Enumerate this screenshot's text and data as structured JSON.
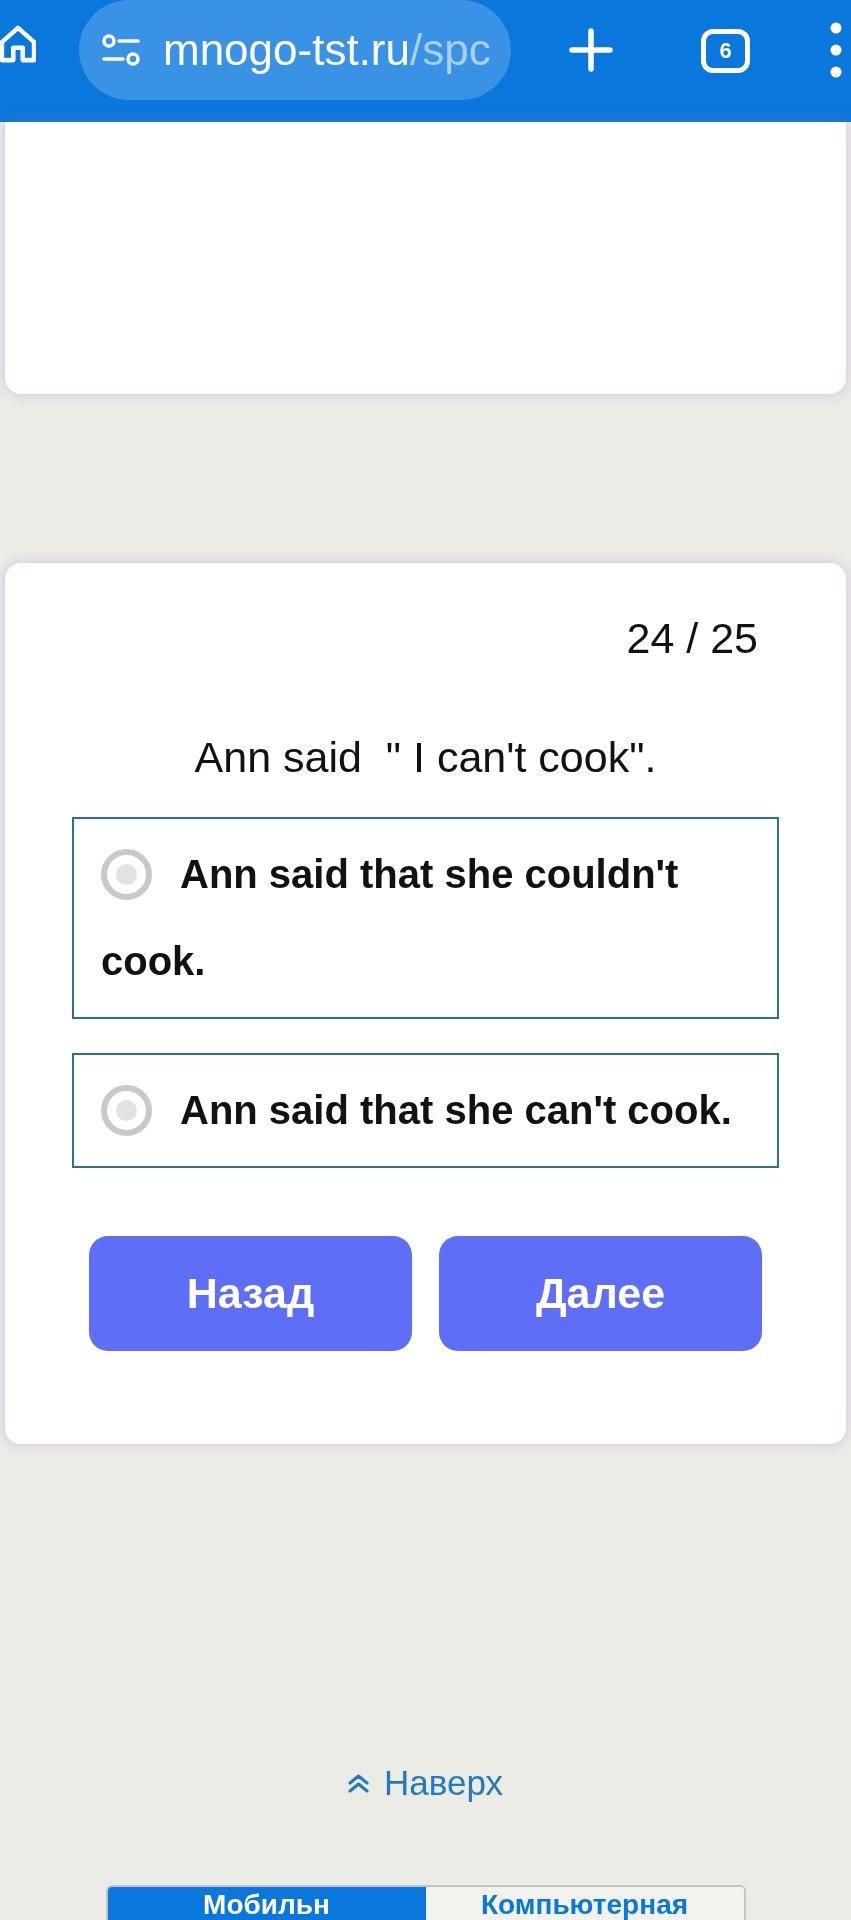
{
  "browser": {
    "url_host": "mnogo-tst.ru",
    "url_path": "/spc",
    "tab_count": "6"
  },
  "quiz": {
    "counter": "24 / 25",
    "question": "Ann said  \" I can't cook\".",
    "options": [
      {
        "text": "Ann said that she couldn't cook.",
        "selected": false
      },
      {
        "text": "Ann said that she can't cook.",
        "selected": false
      }
    ],
    "buttons": [
      "Назад",
      "Далее"
    ]
  },
  "back_to_top": {
    "label": "Наверх"
  },
  "view_switch": [
    {
      "label": "Мобильн",
      "selected": true
    },
    {
      "label": "Компьютерная",
      "selected": false
    }
  ]
}
